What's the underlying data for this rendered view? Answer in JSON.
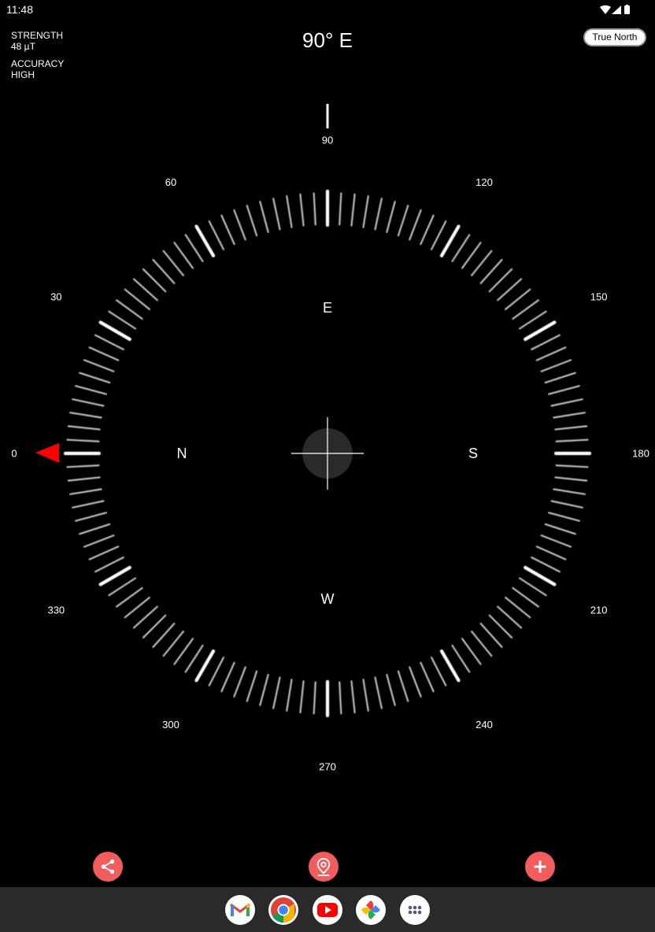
{
  "status_bar": {
    "time": "11:48",
    "icons": [
      "wifi-icon",
      "signal-icon",
      "battery-icon"
    ]
  },
  "readouts": {
    "strength_label": "STRENGTH",
    "strength_value": "48 µT",
    "accuracy_label": "ACCURACY",
    "accuracy_value": "HIGH"
  },
  "heading": "90° E",
  "true_north_button": "True North",
  "compass": {
    "heading_degrees": 90,
    "degree_labels": [
      "0",
      "30",
      "60",
      "90",
      "120",
      "150",
      "180",
      "210",
      "240",
      "270",
      "300",
      "330"
    ],
    "cardinals": [
      "N",
      "E",
      "S",
      "W"
    ],
    "accent_color": "#ff0000"
  },
  "actions": [
    {
      "name": "share-icon"
    },
    {
      "name": "location-pin-icon"
    },
    {
      "name": "add-icon"
    }
  ],
  "dock": {
    "apps": [
      "gmail-icon",
      "chrome-icon",
      "youtube-icon",
      "photos-icon",
      "app-drawer-icon"
    ]
  }
}
